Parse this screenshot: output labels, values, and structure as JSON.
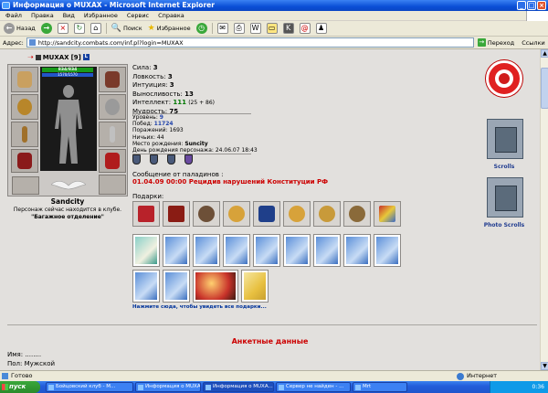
{
  "window": {
    "title": "Информация о MUXAX - Microsoft Internet Explorer",
    "controls": [
      "_",
      "□",
      "×"
    ]
  },
  "menu": [
    "Файл",
    "Правка",
    "Вид",
    "Избранное",
    "Сервис",
    "Справка"
  ],
  "toolbar": {
    "back": "Назад",
    "search": "Поиск",
    "favorites": "Избранное"
  },
  "address": {
    "label": "Адрес:",
    "url": "http://sandcity.combats.com/inf.pl?login=MUXAX",
    "go": "Переход",
    "links": "Ссылки"
  },
  "character": {
    "name": "MUXAX",
    "level": "[9]",
    "hp": "834/834",
    "mp": "1570/1570",
    "location": "Sandcity",
    "status_line1": "Персонаж сейчас находится в клубе.",
    "status_line2": "\"Багажное отделение\""
  },
  "stats": {
    "strength": {
      "label": "Сила:",
      "value": "3"
    },
    "agility": {
      "label": "Ловкость:",
      "value": "3"
    },
    "intuition": {
      "label": "Интуиция:",
      "value": "3"
    },
    "endurance": {
      "label": "Выносливость:",
      "value": "13"
    },
    "intellect": {
      "label": "Интеллект:",
      "value": "111",
      "bonus": "(25 + 86)"
    },
    "wisdom": {
      "label": "Мудрость:",
      "value": "75"
    }
  },
  "info": {
    "level": {
      "label": "Уровень:",
      "value": "9"
    },
    "wins": {
      "label": "Побед:",
      "value": "11724"
    },
    "losses": {
      "label": "Поражений:",
      "value": "1693"
    },
    "draws": {
      "label": "Ничьих:",
      "value": "44"
    },
    "birthplace": {
      "label": "Место рождения:",
      "value": "Suncity"
    },
    "birthdate": {
      "label": "День рождения персонажа:",
      "value": "24.06.07 18:43"
    }
  },
  "paladins": {
    "heading": "Сообщение от паладинов :",
    "alert": "01.04.09 00:00 Рецидив нарушений Конституции РФ"
  },
  "gifts": {
    "label": "Подарки:",
    "colors": [
      "#b8222a",
      "#8a1c14",
      "#6d5038",
      "#d7a23a",
      "#1f3f8a",
      "#d7a23a",
      "#c89a3a",
      "#8a6a3a",
      "#c8322a"
    ]
  },
  "cards": {
    "count_row1": 9,
    "count_row2": 4,
    "link": "Нажмите сюда, чтобы увидеть все подарки..."
  },
  "anketa": {
    "heading": "Анкетные данные",
    "name_label": "Имя:",
    "name_value": "........",
    "sex_label": "Пол:",
    "sex_value": "Мужской"
  },
  "right": {
    "scroll_label": "Scrolls",
    "photo_scroll_label": "Photo Scrolls"
  },
  "statusbar": {
    "status": "Готово",
    "zone": "Интернет"
  },
  "taskbar": {
    "start": "пуск",
    "tasks": [
      "Бойцовский клуб - M...",
      "Информация о MUXA...",
      "Информация о MUXA...",
      "Сервер не найден - ...",
      "Mrt"
    ],
    "clock": "0:36"
  }
}
